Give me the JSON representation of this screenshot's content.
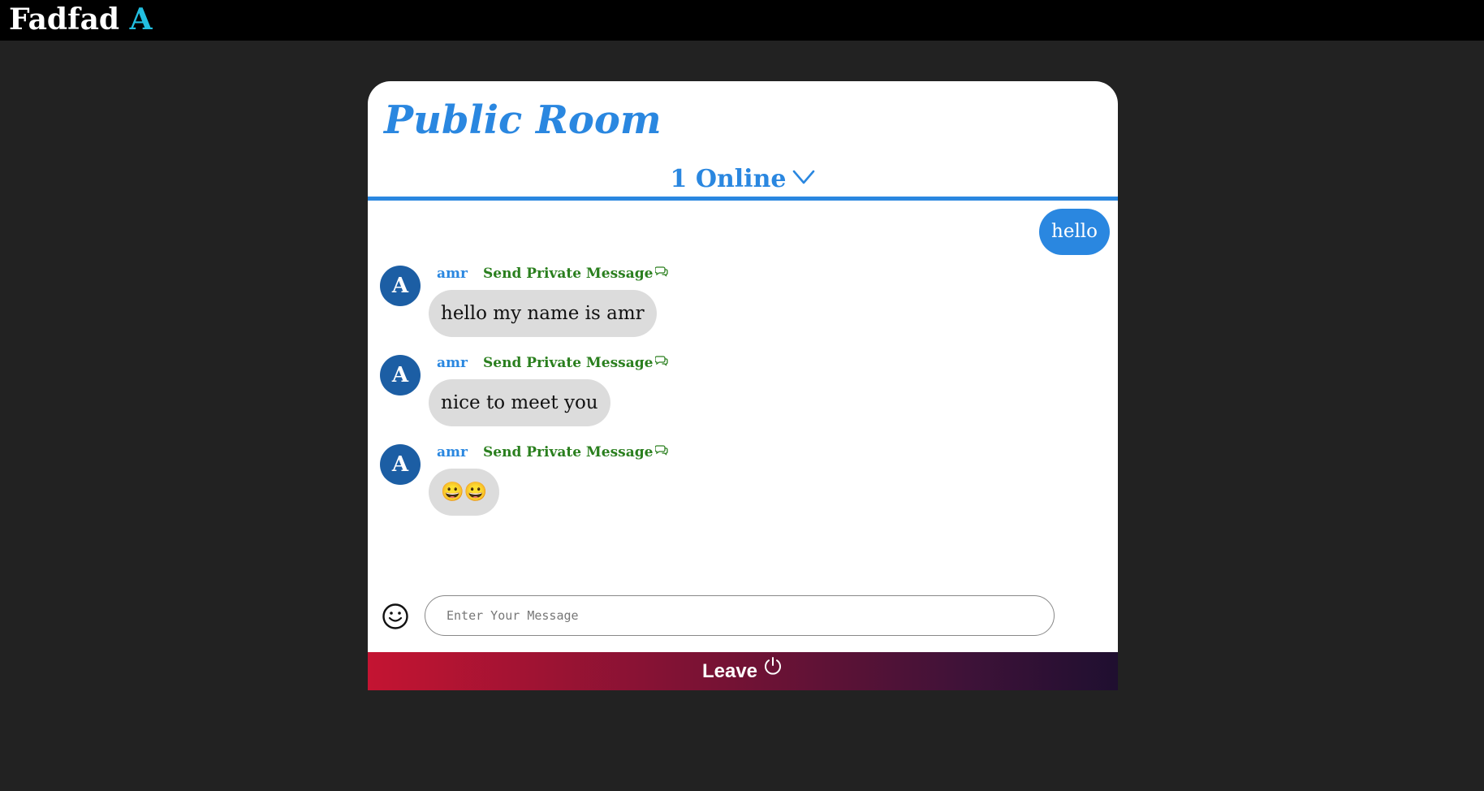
{
  "app": {
    "brand_name": "Fadfad",
    "brand_accent": "A"
  },
  "room": {
    "title": "Public Room",
    "online_label": "1 Online",
    "dropdown_icon": "chevron-down-icon"
  },
  "messages": {
    "mine": [
      {
        "text": "hello"
      }
    ],
    "others": [
      {
        "avatar_letter": "A",
        "sender": "amr",
        "pm_label": "Send Private Message",
        "text": "hello my name is amr"
      },
      {
        "avatar_letter": "A",
        "sender": "amr",
        "pm_label": "Send Private Message",
        "text": "nice to meet you"
      },
      {
        "avatar_letter": "A",
        "sender": "amr",
        "pm_label": "Send Private Message",
        "text": "😀😀"
      }
    ]
  },
  "composer": {
    "placeholder": "Enter Your Message",
    "value": "",
    "emoji_icon": "smiley-icon"
  },
  "leave": {
    "label": "Leave",
    "icon": "power-icon"
  },
  "colors": {
    "accent": "#2a87e0",
    "brand_accent": "#22bfe0",
    "avatar": "#1c5ea4",
    "private_message": "#2a7f1e",
    "bubble_other": "#dcdcdc",
    "background": "#222222"
  }
}
